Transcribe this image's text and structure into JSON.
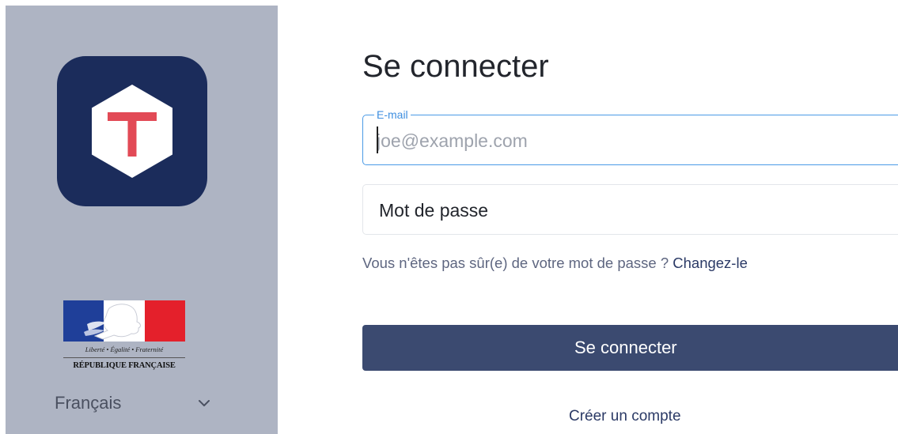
{
  "sidebar": {
    "logo_icon": "tchap-hexagon-t-logo",
    "emblem_motto": "Liberté • Égalité • Fraternité",
    "emblem_title": "RÉPUBLIQUE FRANÇAISE",
    "language": {
      "selected": "Français",
      "icon": "chevron-down-icon"
    }
  },
  "login": {
    "title": "Se connecter",
    "email": {
      "label": "E-mail",
      "value": "",
      "placeholder": "joe@example.com"
    },
    "password": {
      "placeholder": "Mot de passe"
    },
    "hint_text": "Vous n'êtes pas sûr(e) de votre mot de passe ? ",
    "hint_link": "Changez-le",
    "submit_label": "Se connecter",
    "create_account": "Créer un compte"
  },
  "colors": {
    "sidebar_bg": "#aeb4c3",
    "logo_bg": "#1b2c5b",
    "logo_accent": "#e24a56",
    "focus_border": "#4a9ae6",
    "button_bg": "#3b4a70"
  }
}
